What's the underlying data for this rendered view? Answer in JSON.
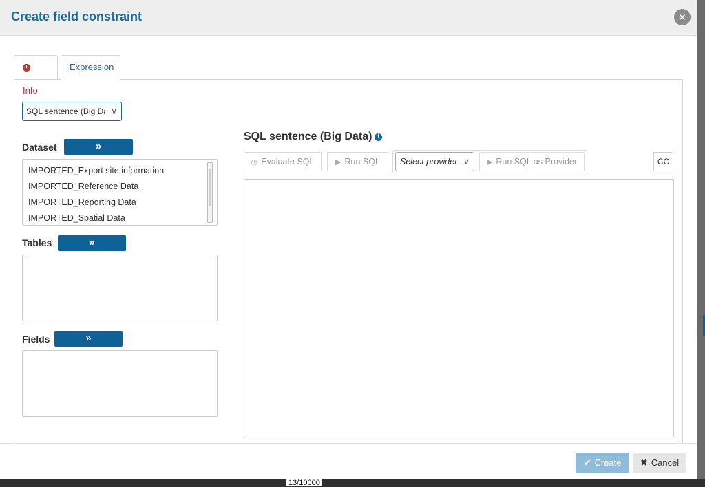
{
  "backdrop": {
    "bottom_text": "13/10000"
  },
  "modal": {
    "title": "Create field constraint",
    "close_icon": "close-icon"
  },
  "tabs": [
    {
      "label": "Info",
      "icon": "exclamation-circle-icon",
      "color": "#c9302c"
    },
    {
      "label": "Expression",
      "active": true
    }
  ],
  "mode_select": {
    "value": "SQL sentence (Big Data)"
  },
  "dataset": {
    "label": "Dataset",
    "expand_icon": "double-chevron-right-icon",
    "items": [
      "IMPORTED_Export site information",
      "IMPORTED_Reference Data",
      "IMPORTED_Reporting Data",
      "IMPORTED_Spatial Data"
    ]
  },
  "tables": {
    "label": "Tables",
    "items": []
  },
  "fields": {
    "label": "Fields",
    "items": []
  },
  "sql": {
    "title": "SQL sentence (Big Data)",
    "info_icon": "info-circle-icon",
    "evaluate_label": "Evaluate SQL",
    "run_label": "Run SQL",
    "provider_placeholder": "Select provider",
    "run_provider_label": "Run SQL as Provider",
    "cc_label": "CC",
    "editor_value": ""
  },
  "footer": {
    "create_label": "Create",
    "cancel_label": "Cancel"
  },
  "colors": {
    "accent": "#1d6a97",
    "primary_button": "#0e6298",
    "create_button": "#8fbcd9",
    "warning": "#c9302c"
  }
}
